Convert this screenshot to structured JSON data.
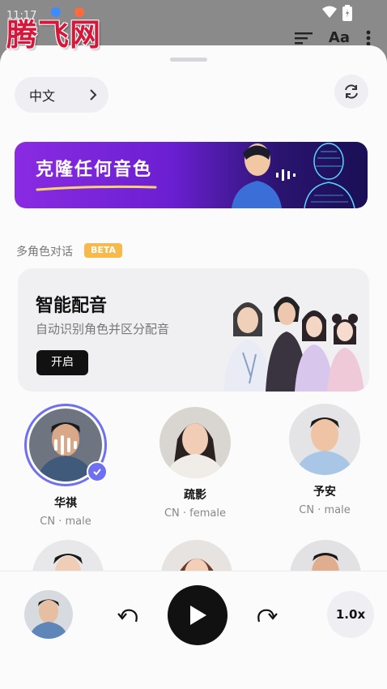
{
  "status": {
    "time": "11:17"
  },
  "watermark": "腾飞网",
  "toolbar": {
    "text_size_label": "Aa"
  },
  "language": {
    "label": "中文"
  },
  "banner": {
    "title": "克隆任何音色"
  },
  "section": {
    "label": "多角色对话",
    "badge": "BETA"
  },
  "card": {
    "title": "智能配音",
    "subtitle": "自动识别角色并区分配音",
    "button": "开启"
  },
  "voices": [
    {
      "name": "华祺",
      "meta": "CN · male",
      "selected": true
    },
    {
      "name": "疏影",
      "meta": "CN · female",
      "selected": false
    },
    {
      "name": "予安",
      "meta": "CN · male",
      "selected": false
    }
  ],
  "player": {
    "speed": "1.0x"
  },
  "colors": {
    "accent": "#6f6ff2",
    "beta": "#f6b94a",
    "watermark": "#d4173a"
  }
}
